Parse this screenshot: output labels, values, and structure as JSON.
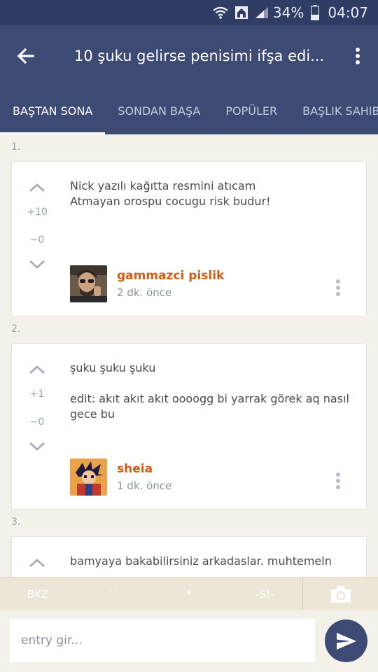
{
  "status_bar": {
    "battery": "34%",
    "time": "04:07"
  },
  "app_bar": {
    "title": "10 şuku gelirse penisimi ifşa edi..."
  },
  "tabs": [
    {
      "label": "BAŞTAN SONA",
      "active": true
    },
    {
      "label": "SONDAN BAŞA",
      "active": false
    },
    {
      "label": "POPÜLER",
      "active": false
    },
    {
      "label": "BAŞLIK SAHIBI",
      "active": false
    }
  ],
  "entries": [
    {
      "number": "1.",
      "up": "+10",
      "down": "−0",
      "text": [
        "Nick yazılı kağıtta resmini atıcam",
        "Atmayan orospu cocugu risk budur!"
      ],
      "author": "gammazci pislik",
      "time": "2 dk. önce"
    },
    {
      "number": "2.",
      "up": "+1",
      "down": "−0",
      "text": [
        "şuku şuku şuku",
        "edit: akıt akıt akıt oooogg bi yarrak görek aq nasıl gece bu"
      ],
      "author": "sheia",
      "time": "1 dk. önce"
    },
    {
      "number": "3.",
      "text": [
        "bamyaya bakabilirsiniz arkadaslar. muhtemeln"
      ]
    }
  ],
  "toolbar": {
    "bkz": "BKZ",
    "backtick": "``",
    "star": "*",
    "spoiler": "-S!-"
  },
  "input": {
    "placeholder": "entry gir..."
  },
  "colors": {
    "primary": "#3d4a74",
    "accent": "#d05e14",
    "background": "#f3f1e9"
  }
}
